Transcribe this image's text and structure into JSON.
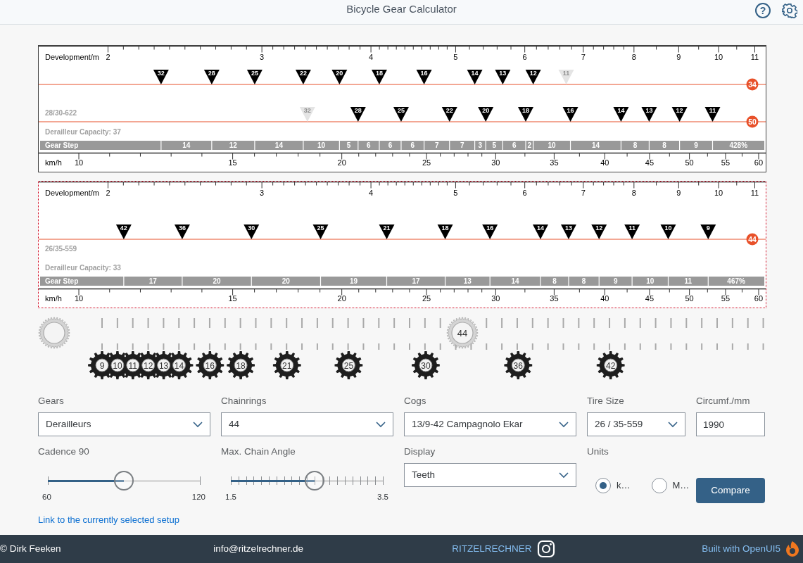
{
  "header": {
    "title": "Bicycle Gear Calculator",
    "help_icon": "?"
  },
  "rulers": [
    {
      "selected": false,
      "development_axis": {
        "title": "Development/m",
        "ticks": [
          {
            "label": "2",
            "level": 0.0953
          },
          {
            "label": "3",
            "level": 0.307
          },
          {
            "label": "4",
            "level": 0.457
          },
          {
            "label": "5",
            "level": 0.5735
          },
          {
            "label": "6",
            "level": 0.6686
          },
          {
            "label": "7",
            "level": 0.7491
          },
          {
            "label": "8",
            "level": 0.8188
          },
          {
            "label": "9",
            "level": 0.8803
          },
          {
            "label": "10",
            "level": 0.9352
          },
          {
            "label": "11",
            "level": 0.985
          }
        ]
      },
      "chainrings": [
        {
          "label": "34",
          "cogs": [
            {
              "label": "32",
              "level": 0.1683,
              "disabled": false
            },
            {
              "label": "28",
              "level": 0.238,
              "disabled": false
            },
            {
              "label": "25",
              "level": 0.2971,
              "disabled": false
            },
            {
              "label": "22",
              "level": 0.3639,
              "disabled": false
            },
            {
              "label": "20",
              "level": 0.4137,
              "disabled": false
            },
            {
              "label": "18",
              "level": 0.4685,
              "disabled": false
            },
            {
              "label": "16",
              "level": 0.5301,
              "disabled": false
            },
            {
              "label": "14",
              "level": 0.5998,
              "disabled": false
            },
            {
              "label": "13",
              "level": 0.6383,
              "disabled": false
            },
            {
              "label": "12",
              "level": 0.6802,
              "disabled": false
            },
            {
              "label": "11",
              "level": 0.7256,
              "disabled": true
            }
          ]
        },
        {
          "label": "50",
          "cogs": [
            {
              "label": "32",
              "level": 0.3696,
              "disabled": true
            },
            {
              "label": "28",
              "level": 0.4393,
              "disabled": false
            },
            {
              "label": "25",
              "level": 0.4985,
              "disabled": false
            },
            {
              "label": "22",
              "level": 0.5651,
              "disabled": false
            },
            {
              "label": "20",
              "level": 0.6149,
              "disabled": false
            },
            {
              "label": "18",
              "level": 0.6699,
              "disabled": false
            },
            {
              "label": "16",
              "level": 0.7314,
              "disabled": false
            },
            {
              "label": "14",
              "level": 0.801,
              "disabled": false
            },
            {
              "label": "13",
              "level": 0.8397,
              "disabled": false
            },
            {
              "label": "12",
              "level": 0.8815,
              "disabled": false
            },
            {
              "label": "11",
              "level": 0.9269,
              "disabled": false
            }
          ]
        }
      ],
      "tire": "28/30-622",
      "capacity": "Derailleur Capacity: 37",
      "gear_step_label": "Gear Step",
      "steps": [
        "14",
        "12",
        "14",
        "10",
        "5",
        "6",
        "6",
        "6",
        "7",
        "7",
        "3",
        "5",
        "6",
        "2",
        "10",
        "14",
        "8",
        "8",
        "9"
      ],
      "range": "428%",
      "speed_axis": {
        "title": "km/h",
        "ticks": [
          {
            "label": "10",
            "level": 0.0552
          },
          {
            "label": "15",
            "level": 0.2668
          },
          {
            "label": "20",
            "level": 0.4169
          },
          {
            "label": "25",
            "level": 0.5334
          },
          {
            "label": "30",
            "level": 0.6286
          },
          {
            "label": "35",
            "level": 0.709
          },
          {
            "label": "40",
            "level": 0.7786
          },
          {
            "label": "45",
            "level": 0.8402
          },
          {
            "label": "50",
            "level": 0.8951
          },
          {
            "label": "55",
            "level": 0.9448
          },
          {
            "label": "60",
            "level": 0.9903
          }
        ]
      }
    },
    {
      "selected": true,
      "development_axis": {
        "title": "Development/m",
        "ticks": [
          {
            "label": "2",
            "level": 0.0953
          },
          {
            "label": "3",
            "level": 0.307
          },
          {
            "label": "4",
            "level": 0.457
          },
          {
            "label": "5",
            "level": 0.5735
          },
          {
            "label": "6",
            "level": 0.6686
          },
          {
            "label": "7",
            "level": 0.7491
          },
          {
            "label": "8",
            "level": 0.8188
          },
          {
            "label": "9",
            "level": 0.8803
          },
          {
            "label": "10",
            "level": 0.9352
          },
          {
            "label": "11",
            "level": 0.985
          }
        ]
      },
      "chainrings": [
        {
          "label": "44",
          "cogs": [
            {
              "label": "42",
              "level": 0.117,
              "disabled": false
            },
            {
              "label": "36",
              "level": 0.1974,
              "disabled": false
            },
            {
              "label": "30",
              "level": 0.2926,
              "disabled": false
            },
            {
              "label": "25",
              "level": 0.3877,
              "disabled": false
            },
            {
              "label": "21",
              "level": 0.4787,
              "disabled": false
            },
            {
              "label": "18",
              "level": 0.5591,
              "disabled": false
            },
            {
              "label": "16",
              "level": 0.6207,
              "disabled": false
            },
            {
              "label": "14",
              "level": 0.6902,
              "disabled": false
            },
            {
              "label": "13",
              "level": 0.7289,
              "disabled": false
            },
            {
              "label": "12",
              "level": 0.7708,
              "disabled": false
            },
            {
              "label": "11",
              "level": 0.8162,
              "disabled": false
            },
            {
              "label": "10",
              "level": 0.8659,
              "disabled": false
            },
            {
              "label": "9",
              "level": 0.9209,
              "disabled": false
            }
          ]
        }
      ],
      "tire": "26/35-559",
      "capacity": "Derailleur Capacity: 33",
      "gear_step_label": "Gear Step",
      "steps": [
        "17",
        "20",
        "20",
        "19",
        "17",
        "13",
        "14",
        "8",
        "8",
        "9",
        "10",
        "11"
      ],
      "range": "467%",
      "speed_axis": {
        "title": "km/h",
        "ticks": [
          {
            "label": "10",
            "level": 0.0552
          },
          {
            "label": "15",
            "level": 0.2668
          },
          {
            "label": "20",
            "level": 0.4169
          },
          {
            "label": "25",
            "level": 0.5334
          },
          {
            "label": "30",
            "level": 0.6286
          },
          {
            "label": "35",
            "level": 0.709
          },
          {
            "label": "40",
            "level": 0.7786
          },
          {
            "label": "45",
            "level": 0.8402
          },
          {
            "label": "50",
            "level": 0.8951
          },
          {
            "label": "55",
            "level": 0.9448
          },
          {
            "label": "60",
            "level": 0.9903
          }
        ]
      }
    }
  ],
  "drivetrain": {
    "chainring": "44",
    "cogs": [
      "9",
      "10",
      "11",
      "12",
      "13",
      "14",
      "16",
      "18",
      "21",
      "25",
      "30",
      "36",
      "42"
    ]
  },
  "form": {
    "gears": {
      "label": "Gears",
      "value": "Derailleurs"
    },
    "chainrings": {
      "label": "Chainrings",
      "value": "44"
    },
    "cogs": {
      "label": "Cogs",
      "value": "13/9-42 Campagnolo Ekar"
    },
    "tire_size": {
      "label": "Tire Size",
      "value": "26 / 35-559"
    },
    "circumference": {
      "label": "Circumf./mm",
      "value": "1990"
    },
    "cadence": {
      "label": "Cadence 90",
      "kind": "end_ticks",
      "level": 0.5,
      "min": "60",
      "max": "120"
    },
    "chain_angle": {
      "label": "Max. Chain Angle",
      "kind": "step_ticks",
      "level": 0.55,
      "min": "1.5",
      "max": "3.5"
    },
    "display": {
      "label": "Display",
      "value": "Teeth"
    },
    "units": {
      "label": "Units",
      "options": [
        {
          "label": "k…",
          "selected": true
        },
        {
          "label": "M…",
          "selected": false
        }
      ]
    },
    "compare_button": "Compare",
    "link": "Link to the currently selected setup"
  },
  "footer": {
    "copyright": "© Dirk Feeken",
    "email": "info@ritzelrechner.de",
    "brand": "RITZELRECHNER",
    "built_with": "Built with OpenUI5"
  }
}
